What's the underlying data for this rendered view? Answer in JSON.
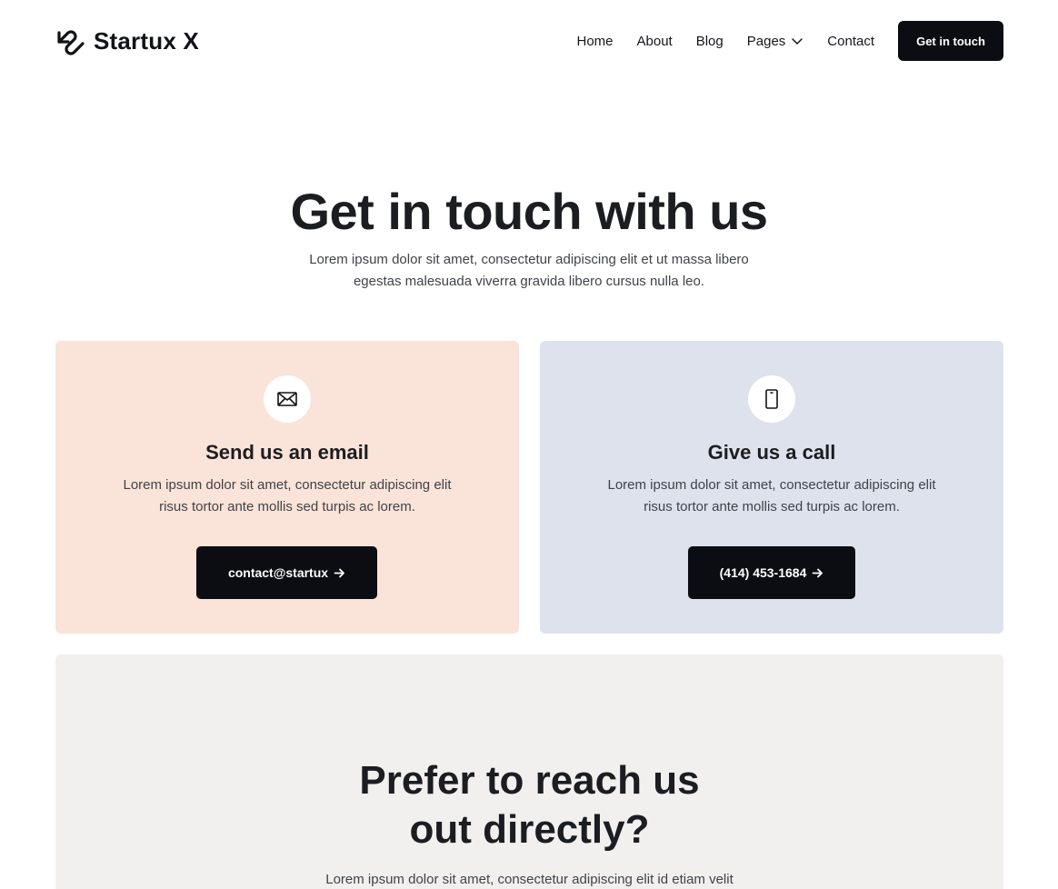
{
  "header": {
    "brand": "Startux X",
    "nav": [
      {
        "label": "Home"
      },
      {
        "label": "About"
      },
      {
        "label": "Blog"
      },
      {
        "label": "Pages",
        "icon": "chevron-down-icon"
      },
      {
        "label": "Contact"
      }
    ],
    "cta_label": "Get in touch"
  },
  "hero": {
    "title": "Get in touch with us",
    "subtitle": "Lorem ipsum dolor sit amet, consectetur adipiscing elit et ut massa libero egestas malesuada viverra gravida libero cursus nulla leo."
  },
  "cards": [
    {
      "icon": "envelope-icon",
      "title": "Send us an email",
      "text": "Lorem ipsum dolor sit amet, consectetur adipiscing elit risus tortor ante mollis sed turpis ac lorem.",
      "button_label": "contact@startux",
      "background": "#fae3d8"
    },
    {
      "icon": "phone-icon",
      "title": "Give us a call",
      "text": "Lorem ipsum dolor sit amet, consectetur adipiscing elit risus tortor ante mollis sed turpis ac lorem.",
      "button_label": "(414) 453-1684",
      "background": "#dde2ec"
    }
  ],
  "direct": {
    "title_line1": "Prefer to reach us",
    "title_line2": "out directly?",
    "text": "Lorem ipsum dolor sit amet, consectetur adipiscing elit id etiam velit"
  },
  "colors": {
    "accent_dark": "#0b0d12",
    "text_muted": "#40434a",
    "section_bg": "#f2f0ef"
  }
}
